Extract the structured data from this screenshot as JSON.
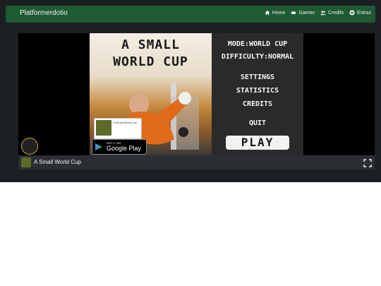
{
  "navbar": {
    "brand": "Platformerdotio",
    "items": [
      {
        "label": "Home",
        "icon": "home-icon"
      },
      {
        "label": "Games",
        "icon": "gamepad-icon"
      },
      {
        "label": "Credits",
        "icon": "users-icon"
      },
      {
        "label": "Extras",
        "icon": "plus-circle-icon"
      }
    ]
  },
  "game": {
    "art": {
      "title_line1": "A SMALL",
      "title_line2": "WORLD CUP",
      "card_title": "A Small World Cup",
      "store_line1": "GET IT ON",
      "store_line2": "Google Play"
    },
    "menu": {
      "mode": "MODE:WORLD CUP",
      "difficulty": "DIFFICULTY:NORMAL",
      "settings": "SETTINGS",
      "statistics": "STATISTICS",
      "credits": "CREDITS",
      "quit": "QUIT",
      "play": "PLAY"
    }
  },
  "bottom_bar": {
    "title": "A Small World Cup"
  }
}
